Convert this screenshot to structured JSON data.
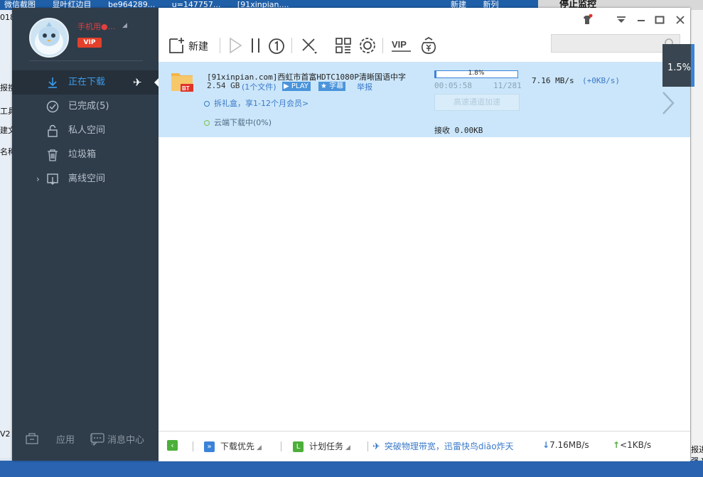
{
  "background": {
    "top_items": [
      "微信截图",
      "显叶红边目",
      "be964289...",
      "u=147757...",
      "[91xinpian....",
      "新建",
      "新列"
    ],
    "right_header": "停止监控",
    "left_fragments": [
      "018",
      "报搜",
      "工具",
      "建文",
      "名称",
      "V2"
    ],
    "right_fragments": [
      "报进",
      "强-V"
    ]
  },
  "sidebar": {
    "username": "手机用●...",
    "vip_label": "VIP",
    "items": [
      {
        "label": "正在下载",
        "icon": "download-arrow-icon",
        "active": true
      },
      {
        "label": "已完成(5)",
        "icon": "check-circle-icon",
        "active": false
      },
      {
        "label": "私人空间",
        "icon": "lock-icon",
        "active": false
      },
      {
        "label": "垃圾箱",
        "icon": "trash-icon",
        "active": false
      },
      {
        "label": "离线空间",
        "icon": "offline-space-icon",
        "active": false
      }
    ],
    "bottom": {
      "apps_label": "应用",
      "messages_label": "消息中心"
    }
  },
  "toolbar": {
    "new_label": "新建",
    "search_placeholder": "",
    "tooltip": "1.5%"
  },
  "task": {
    "name": "[91xinpian.com]西虹市首富HDTC1080P清晰国语中字",
    "size": "2.54 GB",
    "files": "(1个文件)",
    "play_label": "PLAY",
    "subtitle_label": "字幕",
    "report_label": "举报",
    "gift_text": "拆礼盒，享1-12个月会员>",
    "cloud_text": "云端下载中(0%)",
    "file_type_badge": "BT",
    "progress_percent": 1.8,
    "progress_label": "1.8%",
    "time_left": "00:05:58",
    "pieces": "11/281",
    "speed": "7.16  MB/s",
    "speed_extra": "(+0KB/s)",
    "accel_label": "高速通道加速",
    "received": "接收 0.00KB"
  },
  "statusbar": {
    "priority_label": "下载优先",
    "plan_label": "计划任务",
    "promo_text": "突破物理带宽，迅雷快鸟diāo炸天",
    "down_speed": "7.16MB/s",
    "up_speed": "<1KB/s"
  },
  "colors": {
    "sidebar_bg": "#2f3c49",
    "accent_blue": "#3b83d9",
    "task_row_bg": "#cbe6fa",
    "vip_red": "#e2402b"
  }
}
